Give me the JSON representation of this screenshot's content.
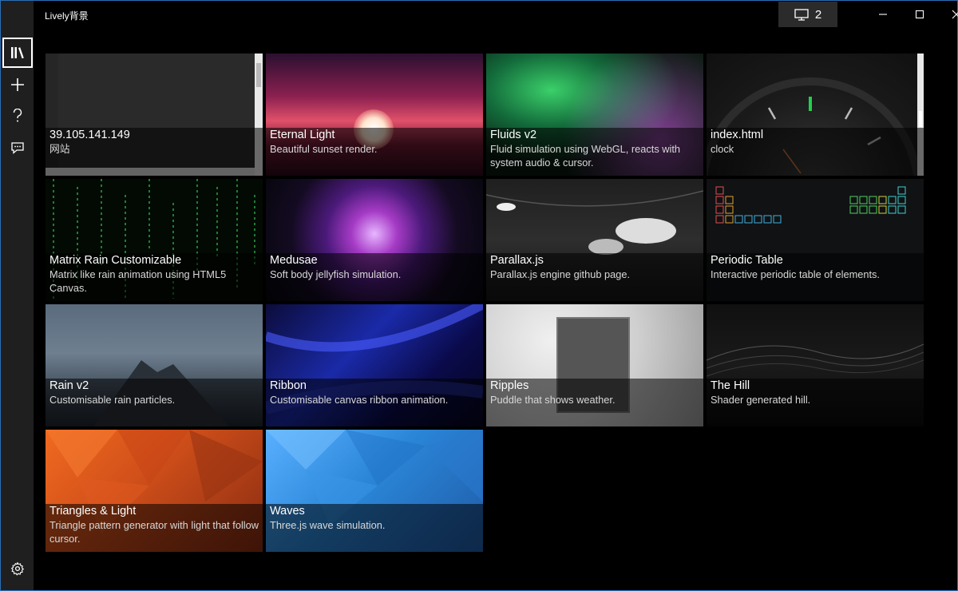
{
  "app": {
    "title": "Lively背景"
  },
  "titlebar": {
    "monitor_count": "2"
  },
  "nav": {
    "items": [
      {
        "name": "library",
        "icon": "library-icon",
        "active": true
      },
      {
        "name": "add",
        "icon": "plus-icon",
        "active": false
      },
      {
        "name": "help",
        "icon": "help-icon",
        "active": false
      },
      {
        "name": "feedback",
        "icon": "feedback-icon",
        "active": false
      }
    ],
    "settings_icon": "gear-icon"
  },
  "cards": [
    {
      "title": "39.105.141.149",
      "desc": "网站"
    },
    {
      "title": "Eternal Light",
      "desc": "Beautiful sunset render."
    },
    {
      "title": "Fluids v2",
      "desc": "Fluid simulation using WebGL, reacts with system audio & cursor."
    },
    {
      "title": "index.html",
      "desc": "clock",
      "selected": true
    },
    {
      "title": "Matrix Rain Customizable",
      "desc": "Matrix like rain animation using HTML5 Canvas."
    },
    {
      "title": "Medusae",
      "desc": "Soft body jellyfish simulation."
    },
    {
      "title": "Parallax.js",
      "desc": "Parallax.js engine github page."
    },
    {
      "title": "Periodic Table",
      "desc": "Interactive periodic table of elements."
    },
    {
      "title": "Rain v2",
      "desc": "Customisable rain particles."
    },
    {
      "title": "Ribbon",
      "desc": "Customisable canvas ribbon animation."
    },
    {
      "title": "Ripples",
      "desc": "Puddle that shows weather."
    },
    {
      "title": "The Hill",
      "desc": "Shader generated hill."
    },
    {
      "title": "Triangles & Light",
      "desc": "Triangle pattern generator with light that follow cursor."
    },
    {
      "title": "Waves",
      "desc": "Three.js wave simulation."
    }
  ],
  "colors": {
    "accent": "#2a86d8",
    "nav_bg": "#1f1f1f",
    "bg": "#000000"
  }
}
